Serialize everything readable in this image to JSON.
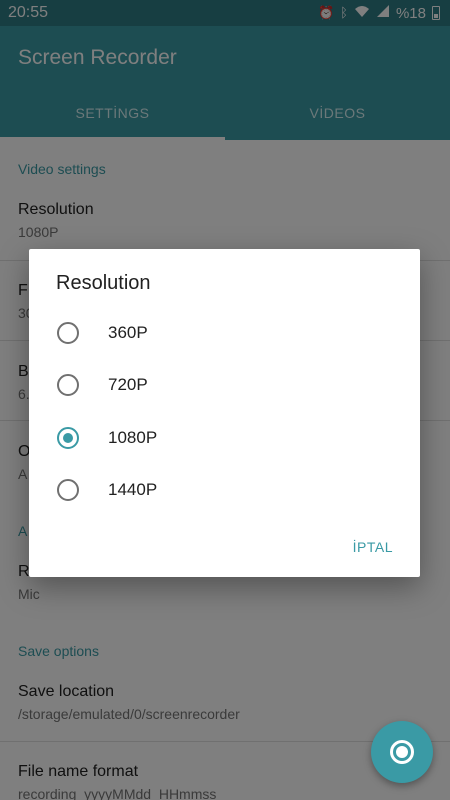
{
  "status_bar": {
    "time": "20:55",
    "battery_text": "%18",
    "icons": [
      "alarm-icon",
      "bluetooth-icon",
      "wifi-icon",
      "signal-icon",
      "battery-icon"
    ]
  },
  "app_bar": {
    "title": "Screen Recorder",
    "tabs": [
      {
        "label": "SETTİNGS",
        "active": true
      },
      {
        "label": "VİDEOS",
        "active": false
      }
    ]
  },
  "settings": {
    "video_category": "Video settings",
    "resolution": {
      "title": "Resolution",
      "summary": "1080P"
    },
    "frame_rate": {
      "title": "F",
      "summary": "30"
    },
    "bit_rate": {
      "title": "B",
      "summary": "6."
    },
    "orientation": {
      "title": "O",
      "summary": "A"
    },
    "audio_category": "A",
    "audio_source": {
      "title": "R",
      "summary": "Mic"
    },
    "save_category": "Save options",
    "save_location": {
      "title": "Save location",
      "summary": "/storage/emulated/0/screenrecorder"
    },
    "file_name_format": {
      "title": "File name format",
      "summary": "recording_yyyyMMdd_HHmmss"
    }
  },
  "dialog": {
    "title": "Resolution",
    "options": [
      {
        "label": "360P",
        "selected": false
      },
      {
        "label": "720P",
        "selected": false
      },
      {
        "label": "1080P",
        "selected": true
      },
      {
        "label": "1440P",
        "selected": false
      }
    ],
    "cancel_label": "İPTAL"
  },
  "fab": {
    "icon": "record-icon"
  },
  "colors": {
    "primary": "#3a9aa5",
    "primary_dark": "#2f7c85",
    "accent": "#3a9aa5"
  }
}
